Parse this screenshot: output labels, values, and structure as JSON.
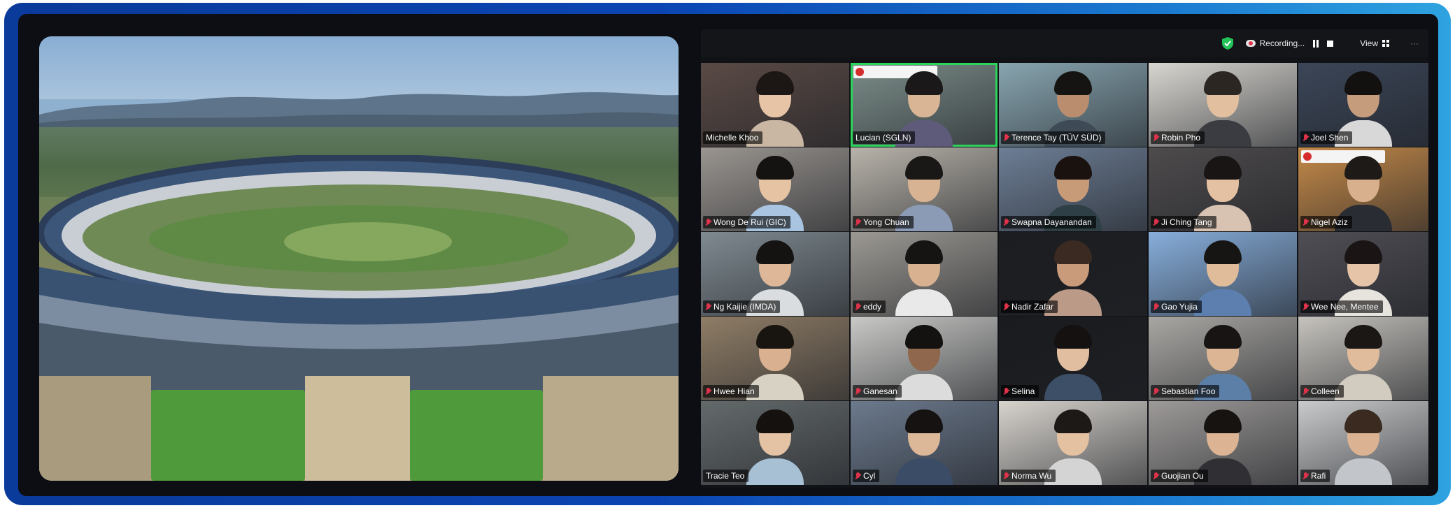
{
  "zoom": {
    "recording_label": "Recording...",
    "view_label": "View",
    "more_label": "···"
  },
  "participants": [
    {
      "name": "Michelle Khoo",
      "muted": false,
      "bg": "#5a4a45",
      "skin": "#e8c4a6",
      "hair": "#1c1614",
      "shirt": "#c9b7a4"
    },
    {
      "name": "Lucian (SGLN)",
      "muted": false,
      "active": true,
      "bg": "#7c8e8a",
      "skin": "#d9b596",
      "hair": "#1a1818",
      "shirt": "#5e5a7a",
      "banner": true
    },
    {
      "name": "Terence Tay (TÜV SÜD)",
      "muted": true,
      "bg": "#88a5b0",
      "skin": "#b98d6e",
      "hair": "#161412",
      "shirt": "#3e4a55"
    },
    {
      "name": "Robin Pho",
      "muted": true,
      "bg": "#d8d6d0",
      "skin": "#e2bf9e",
      "hair": "#2b2621",
      "shirt": "#3a3c42"
    },
    {
      "name": "Joel Shen",
      "muted": true,
      "bg": "#3b4658",
      "skin": "#c59c7c",
      "hair": "#121110",
      "shirt": "#d8d8d8"
    },
    {
      "name": "Wong De Rui (GIC)",
      "muted": true,
      "bg": "#9a9590",
      "skin": "#e6c3a3",
      "hair": "#151312",
      "shirt": "#a9c4e0"
    },
    {
      "name": "Yong Chuan",
      "muted": true,
      "bg": "#b8b3aa",
      "skin": "#d8b393",
      "hair": "#1a1816",
      "shirt": "#8b9bb6"
    },
    {
      "name": "Swapna Dayanandan",
      "muted": true,
      "bg": "#6d7e95",
      "skin": "#c79a78",
      "hair": "#1a120e",
      "shirt": "#2e4046"
    },
    {
      "name": "Ji Ching Tang",
      "muted": true,
      "bg": "#4e4b4c",
      "skin": "#e5c1a3",
      "hair": "#191514",
      "shirt": "#d8c2b2"
    },
    {
      "name": "Nigel Aziz",
      "muted": true,
      "bg": "#c58a49",
      "skin": "#d8b08e",
      "hair": "#1d1a18",
      "shirt": "#2a2c33",
      "banner": true
    },
    {
      "name": "Ng Kaijie (IMDA)",
      "muted": true,
      "bg": "#7f8a90",
      "skin": "#ddb798",
      "hair": "#151312",
      "shirt": "#d9dde0"
    },
    {
      "name": "eddy",
      "muted": true,
      "bg": "#9c9993",
      "skin": "#d7b190",
      "hair": "#161413",
      "shirt": "#e9e9ea"
    },
    {
      "name": "Nadir Zafar",
      "muted": true,
      "bg": "#1c1d20",
      "skin": "#c99b7b",
      "hair": "#3a2a22",
      "shirt": "#bb9a88"
    },
    {
      "name": "Gao Yujia",
      "muted": true,
      "bg": "#87aedb",
      "skin": "#e1bc9b",
      "hair": "#171514",
      "shirt": "#5c7fb0"
    },
    {
      "name": "Wee Nee, Mentee",
      "muted": true,
      "bg": "#4f4e55",
      "skin": "#e6c4a7",
      "hair": "#1a1514",
      "shirt": "#e7e3dd"
    },
    {
      "name": "Hwee Hian",
      "muted": true,
      "bg": "#8f7d66",
      "skin": "#d9b090",
      "hair": "#18140f",
      "shirt": "#d8d2c4"
    },
    {
      "name": "Ganesan",
      "muted": true,
      "bg": "#c9c9c6",
      "skin": "#8f674d",
      "hair": "#141210",
      "shirt": "#dcdcdc"
    },
    {
      "name": "Selina",
      "muted": true,
      "bg": "#1a1b1e",
      "skin": "#e2bea1",
      "hair": "#141110",
      "shirt": "#3d4f66"
    },
    {
      "name": "Sebastian Foo",
      "muted": true,
      "bg": "#a9a7a3",
      "skin": "#dbb594",
      "hair": "#171413",
      "shirt": "#5c7fa8"
    },
    {
      "name": "Colleen",
      "muted": true,
      "bg": "#c6c3bd",
      "skin": "#e0bc9c",
      "hair": "#1b1714",
      "shirt": "#d2cbc0"
    },
    {
      "name": "Tracie Teo",
      "muted": false,
      "bg": "#646a6b",
      "skin": "#e4c2a4",
      "hair": "#14110f",
      "shirt": "#a7c0d4"
    },
    {
      "name": "Cyl",
      "muted": true,
      "bg": "#6c7a8d",
      "skin": "#ddb898",
      "hair": "#151211",
      "shirt": "#3b4c66"
    },
    {
      "name": "Norma Wu",
      "muted": true,
      "bg": "#d7d3cd",
      "skin": "#e4c1a1",
      "hair": "#1d1916",
      "shirt": "#d4d4d4"
    },
    {
      "name": "Guojian Ou",
      "muted": true,
      "bg": "#9d9a98",
      "skin": "#dcb493",
      "hair": "#161311",
      "shirt": "#302f33"
    },
    {
      "name": "Rafi",
      "muted": true,
      "bg": "#c8cacb",
      "skin": "#dcb392",
      "hair": "#3a2a1f",
      "shirt": "#c2c6cb"
    }
  ]
}
